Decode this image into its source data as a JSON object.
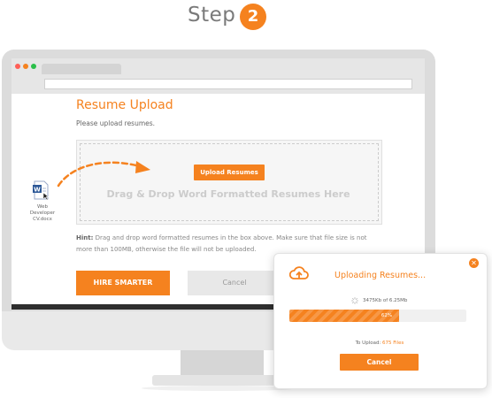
{
  "header": {
    "step_label": "Step",
    "step_number": "2"
  },
  "colors": {
    "accent": "#f5821f",
    "chrome": "#e6e6e6",
    "bezel": "#dcdcdc"
  },
  "browser": {
    "window_dots": [
      "#ff5f57",
      "#f5821f",
      "#2bbf4a"
    ]
  },
  "page": {
    "heading": "Resume Upload",
    "subtitle": "Please upload resumes.",
    "upload_button": "Upload Resumes",
    "drop_text": "Drag & Drop Word Formatted Resumes Here",
    "hint_label": "Hint:",
    "hint_line1": " Drag and drop word formatted resumes in the box above. Make sure that file size is not",
    "hint_line2": "more than 100MB, otherwise the file will not be uploaded.",
    "hire_button": "HIRE SMARTER",
    "cancel_button": "Cancel"
  },
  "word_file": {
    "icon": "word-document-icon",
    "label_line1": "Web",
    "label_line2": "Developer",
    "label_line3": "CV.docx"
  },
  "popup": {
    "title": "Uploading Resumes...",
    "size_text": "3475Kb of 6.25Mb",
    "progress_percent": 62,
    "progress_label": "62%",
    "to_upload_prefix": "To Upload: ",
    "to_upload_count": "675 Files",
    "cancel_button": "Cancel",
    "icons": [
      "cloud-upload-icon",
      "spinner-icon",
      "close-icon"
    ]
  }
}
